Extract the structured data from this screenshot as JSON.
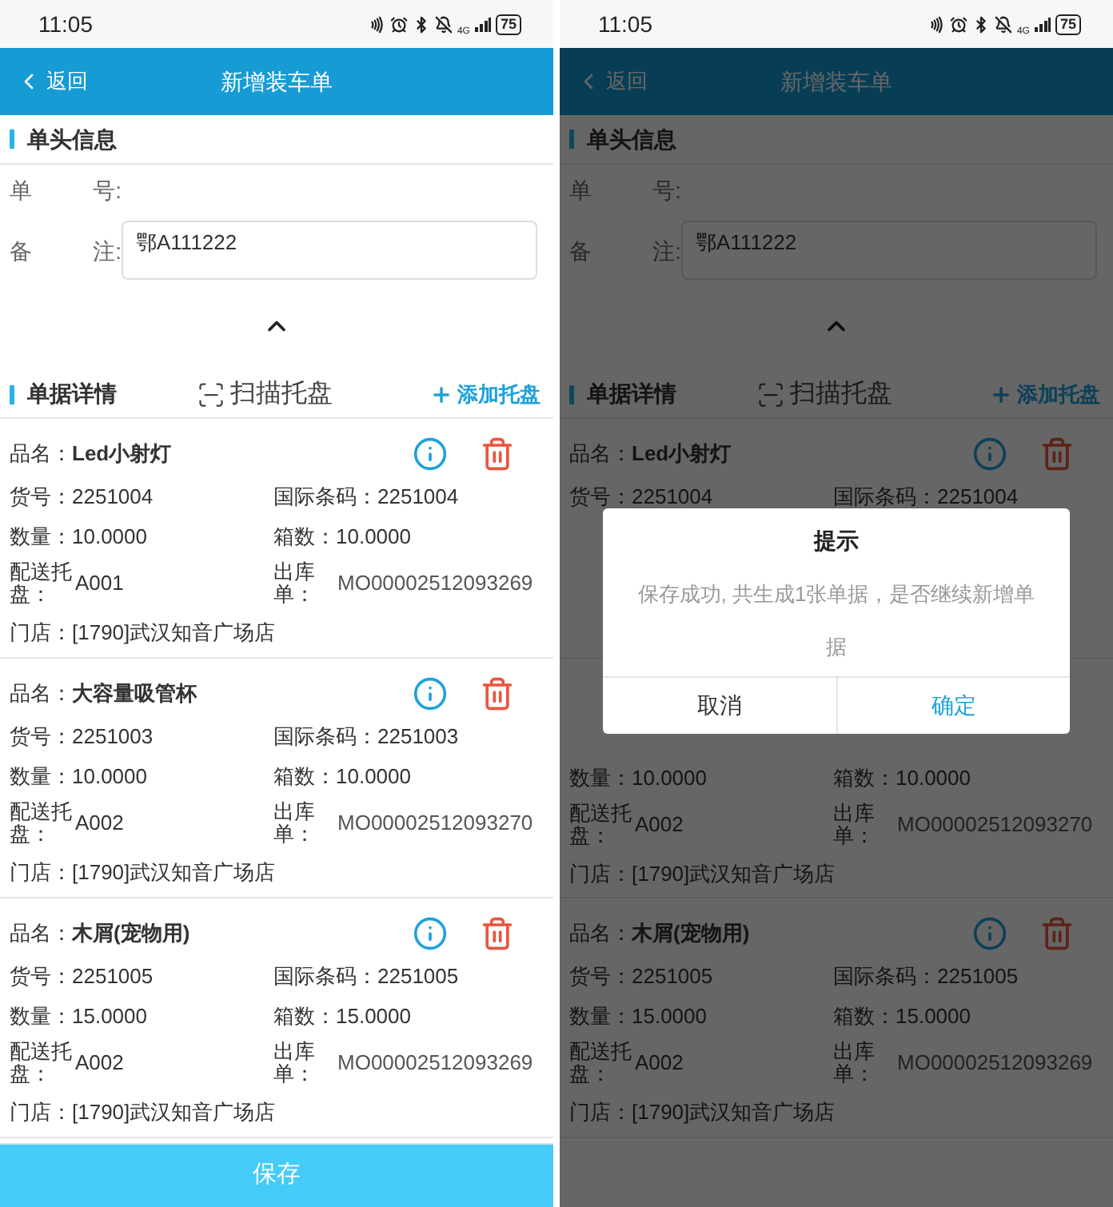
{
  "screens": [
    {
      "status_bar": {
        "time": "11:05",
        "network": "4G",
        "battery": "75"
      },
      "nav": {
        "back": "返回",
        "title": "新增装车单"
      },
      "header_section": {
        "title": "单头信息",
        "fields": [
          {
            "kind": "text",
            "label": [
              "单",
              "号:"
            ]
          },
          {
            "kind": "textarea",
            "label": [
              "备",
              "注:"
            ],
            "value": "鄂A111222"
          }
        ]
      },
      "detail_section": {
        "title": "单据详情",
        "scan": "扫描托盘",
        "add": "添加托盘"
      },
      "items": [
        {
          "name_label": "品名：",
          "name": "Led小射灯",
          "fields": [
            {
              "kind": "inline",
              "label": "货号：",
              "value": "2251004"
            },
            {
              "kind": "inline",
              "label": "国际条码：",
              "value": "2251004"
            },
            {
              "kind": "inline",
              "label": "数量：",
              "value": "10.0000"
            },
            {
              "kind": "inline",
              "label": "箱数：",
              "value": "10.0000"
            },
            {
              "kind": "wrap",
              "label": "配送托盘：",
              "value": "A001"
            },
            {
              "kind": "wrap",
              "label": "出库单：",
              "value": "MO00002512093269"
            }
          ],
          "store_label": "门店：",
          "store": "[1790]武汉知音广场店"
        },
        {
          "name_label": "品名：",
          "name": "大容量吸管杯",
          "fields": [
            {
              "kind": "inline",
              "label": "货号：",
              "value": "2251003"
            },
            {
              "kind": "inline",
              "label": "国际条码：",
              "value": "2251003"
            },
            {
              "kind": "inline",
              "label": "数量：",
              "value": "10.0000"
            },
            {
              "kind": "inline",
              "label": "箱数：",
              "value": "10.0000"
            },
            {
              "kind": "wrap",
              "label": "配送托盘：",
              "value": "A002"
            },
            {
              "kind": "wrap",
              "label": "出库单：",
              "value": "MO00002512093270"
            }
          ],
          "store_label": "门店：",
          "store": "[1790]武汉知音广场店"
        },
        {
          "name_label": "品名：",
          "name": "木屑(宠物用)",
          "fields": [
            {
              "kind": "inline",
              "label": "货号：",
              "value": "2251005"
            },
            {
              "kind": "inline",
              "label": "国际条码：",
              "value": "2251005"
            },
            {
              "kind": "inline",
              "label": "数量：",
              "value": "15.0000"
            },
            {
              "kind": "inline",
              "label": "箱数：",
              "value": "15.0000"
            },
            {
              "kind": "wrap",
              "label": "配送托盘：",
              "value": "A002"
            },
            {
              "kind": "wrap",
              "label": "出库单：",
              "value": "MO00002512093269"
            }
          ],
          "store_label": "门店：",
          "store": "[1790]武汉知音广场店"
        }
      ],
      "save_button": "保存"
    },
    {
      "status_bar": {
        "time": "11:05",
        "network": "4G",
        "battery": "75"
      },
      "nav": {
        "back": "返回",
        "title": "新增装车单"
      },
      "header_section": {
        "title": "单头信息",
        "fields": [
          {
            "kind": "text",
            "label": [
              "单",
              "号:"
            ]
          },
          {
            "kind": "textarea",
            "label": [
              "备",
              "注:"
            ],
            "value": "鄂A111222"
          }
        ]
      },
      "detail_section": {
        "title": "单据详情",
        "scan": "扫描托盘",
        "add": "添加托盘"
      },
      "items": [
        {
          "kind": "head",
          "name_label": "品名：",
          "name": "Led小射灯",
          "fields": [
            {
              "kind": "inline",
              "label": "货号：",
              "value": "2251004"
            },
            {
              "kind": "inline",
              "label": "国际条码：",
              "value": "2251004"
            }
          ]
        },
        {
          "kind": "tail",
          "fields": [
            {
              "kind": "inline",
              "label": "数量：",
              "value": "10.0000"
            },
            {
              "kind": "inline",
              "label": "箱数：",
              "value": "10.0000"
            },
            {
              "kind": "wrap",
              "label": "配送托盘：",
              "value": "A002"
            },
            {
              "kind": "wrap",
              "label": "出库单：",
              "value": "MO00002512093270"
            }
          ],
          "store_label": "门店：",
          "store": "[1790]武汉知音广场店"
        },
        {
          "kind": "full",
          "name_label": "品名：",
          "name": "木屑(宠物用)",
          "fields": [
            {
              "kind": "inline",
              "label": "货号：",
              "value": "2251005"
            },
            {
              "kind": "inline",
              "label": "国际条码：",
              "value": "2251005"
            },
            {
              "kind": "inline",
              "label": "数量：",
              "value": "15.0000"
            },
            {
              "kind": "inline",
              "label": "箱数：",
              "value": "15.0000"
            },
            {
              "kind": "wrap",
              "label": "配送托盘：",
              "value": "A002"
            },
            {
              "kind": "wrap",
              "label": "出库单：",
              "value": "MO00002512093269"
            }
          ],
          "store_label": "门店：",
          "store": "[1790]武汉知音广场店"
        }
      ],
      "dialog": {
        "title": "提示",
        "message": "保存成功, 共生成1张单据，是否继续新增单据",
        "buttons": [
          {
            "kind": "cancel",
            "label": "取消"
          },
          {
            "kind": "confirm",
            "label": "确定"
          }
        ]
      }
    }
  ]
}
